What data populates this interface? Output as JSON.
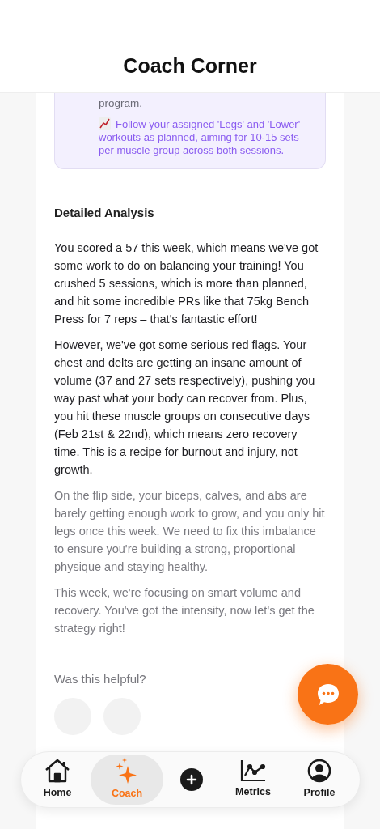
{
  "header": {
    "title": "Coach Corner"
  },
  "tip_box": {
    "lines": [
      "program.",
      "Follow your assigned 'Legs' and 'Lower' workouts as planned, aiming for 10-15 sets per muscle group across both sessions."
    ]
  },
  "analysis": {
    "heading": "Detailed Analysis",
    "paragraphs": [
      {
        "text": "You scored a 57 this week, which means we've got some work to do on balancing your training! You crushed 5 sessions, which is more than planned, and hit some incredible PRs like that 75kg Bench Press for 7 reps – that's fantastic effort!",
        "muted": false
      },
      {
        "text": "However, we've got some serious red flags. Your chest and delts are getting an insane amount of volume (37 and 27 sets respectively), pushing you way past what your body can recover from. Plus, you hit these muscle groups on consecutive days (Feb 21st & 22nd), which means zero recovery time. This is a recipe for burnout and injury, not growth.",
        "muted": false
      },
      {
        "text": "On the flip side, your biceps, calves, and abs are barely getting enough work to grow, and you only hit legs once this week. We need to fix this imbalance to ensure you're building a strong, proportional physique and staying healthy.",
        "muted": true
      },
      {
        "text": "This week, we're focusing on smart volume and recovery. You've got the intensity, now let's get the strategy right!",
        "muted": true
      }
    ]
  },
  "feedback": {
    "question": "Was this helpful?"
  },
  "nav": [
    {
      "kind": "home",
      "label": "Home",
      "selected": false
    },
    {
      "kind": "coach",
      "label": "Coach",
      "selected": true
    },
    {
      "kind": "add"
    },
    {
      "kind": "metrics",
      "label": "Metrics",
      "selected": false
    },
    {
      "kind": "profile",
      "label": "Profile",
      "selected": false
    }
  ]
}
